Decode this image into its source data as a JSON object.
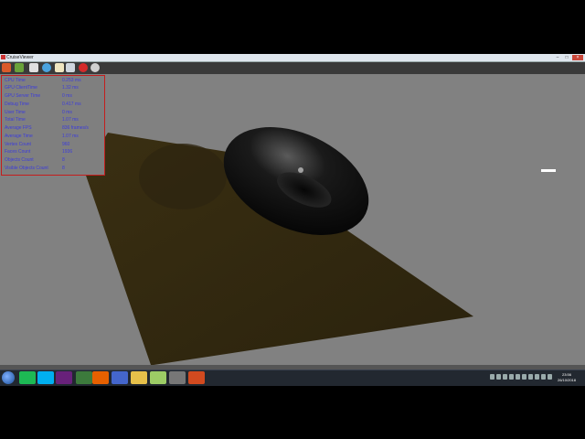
{
  "window": {
    "title": "CruiseViewer"
  },
  "stats_panel": {
    "rows": [
      {
        "label": "CPU Time",
        "value": "0.253 ms"
      },
      {
        "label": "GPU ClientTime",
        "value": "1.32 ms"
      },
      {
        "label": "GPU Server Time",
        "value": "0 ms"
      },
      {
        "label": "Debug Time",
        "value": "0.417 ms"
      },
      {
        "label": "User Time",
        "value": "0 ms"
      },
      {
        "label": "Total Time",
        "value": "1.07 ms"
      },
      {
        "label": "Average FPS",
        "value": "836 frames/s"
      },
      {
        "label": "Average Time",
        "value": "1.07 ms"
      },
      {
        "label": "Vertex Count",
        "value": "960"
      },
      {
        "label": "Faces Count",
        "value": "1936"
      },
      {
        "label": "Objects Count",
        "value": "8"
      },
      {
        "label": "Visible Objects Count",
        "value": "8"
      }
    ]
  },
  "toolbar": {
    "icons": [
      "model-icon",
      "palette-icon",
      "screenshot-icon",
      "shield-icon",
      "document-icon",
      "monitor-icon",
      "record-icon",
      "zoom-icon"
    ]
  },
  "taskbar": {
    "apps": [
      "spotify-icon",
      "skype-icon",
      "visual-studio-icon",
      "wireshark-icon",
      "firefox-icon",
      "paint-icon",
      "explorer-icon",
      "notepad-icon",
      "tools-icon",
      "cruiseviewer-icon"
    ],
    "clock_time": "23:56",
    "clock_date": "26/10/2018"
  },
  "colors": {
    "stats_border": "#c41d1d",
    "stats_text": "#3b3bdc",
    "viewport_bg": "#818181",
    "ground": "#2f2610"
  }
}
